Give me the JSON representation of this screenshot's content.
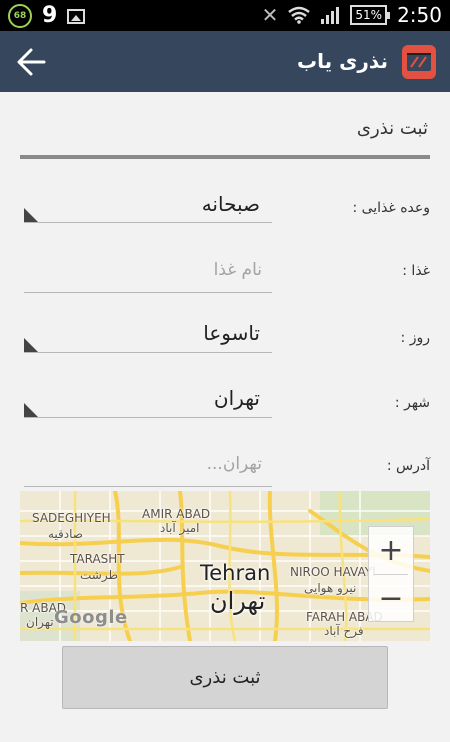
{
  "status_bar": {
    "battery_ring": "68",
    "notification_digit": "9",
    "battery_percent": "51%",
    "time": "2:50"
  },
  "app_bar": {
    "title": "نذری یاب"
  },
  "form": {
    "section_title": "ثبت نذری",
    "meal_label": "وعده غذایی :",
    "meal_value": "صبحانه",
    "food_label": "غذا :",
    "food_placeholder": "نام غذا",
    "day_label": "روز :",
    "day_value": "تاسوعا",
    "city_label": "شهر :",
    "city_value": "تهران",
    "address_label": "آدرس :",
    "address_placeholder": "تهران..."
  },
  "map": {
    "labels": {
      "sadeghiyeh": "SADEGHIYEH",
      "sadeghiyeh_fa": "صادقیه",
      "amir_abad": "AMIR ABAD",
      "amir_abad_fa": "امیر آباد",
      "tarasht": "TARASHT",
      "tarasht_fa": "طرشت",
      "niroo_havayi": "NIROO HAVAYI",
      "niroo_havayi_fa": "نیرو هوایی",
      "farah_abad": "FARAH ABAD",
      "farah_abad_fa": "فرح آباد",
      "r_abad": "R ABAD",
      "r_abad_fa": "تهران",
      "city": "Tehran",
      "city_fa": "تهران"
    },
    "attribution": "Google",
    "zoom_in": "+",
    "zoom_out": "−"
  },
  "submit": {
    "label": "ثبت نذری"
  },
  "colors": {
    "app_bar": "#36465d",
    "logo": "#e35142",
    "background": "#f2f2f2"
  }
}
